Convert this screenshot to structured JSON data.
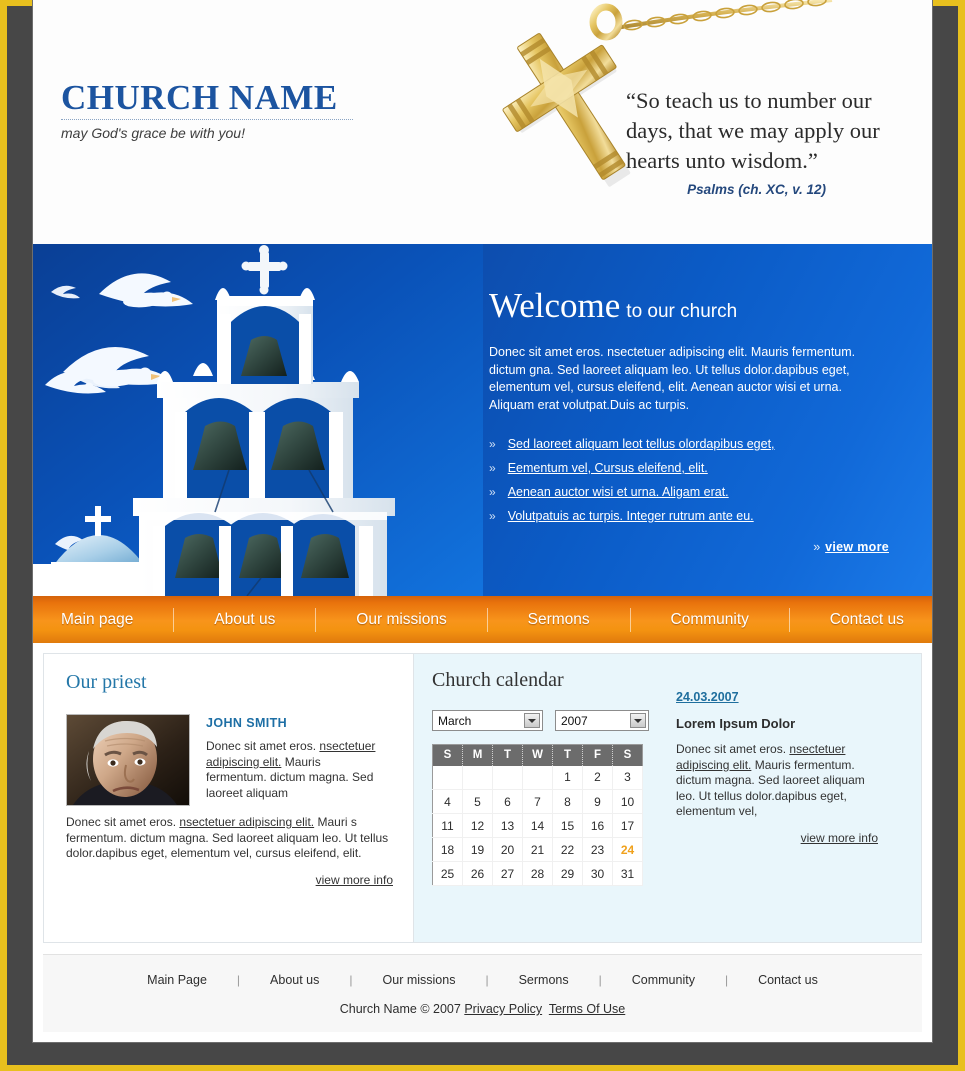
{
  "header": {
    "church_name": "CHURCH NAME",
    "tagline": "may God's grace be with you!",
    "quote": "“So teach us to number our days, that we may apply our hearts unto wisdom.”",
    "quote_source": "Psalms (ch. XC, v. 12)",
    "art_icon": "gold-cross-necklace"
  },
  "hero": {
    "heading_main": "Welcome",
    "heading_sub": "to our church",
    "paragraph": "Donec sit amet eros. nsectetuer adipiscing elit. Mauris fermentum. dictum gna. Sed laoreet aliquam leo. Ut tellus dolor.dapibus eget, elementum vel, cursus eleifend, elit. Aenean auctor wisi et urna. Aliquam erat volutpat.Duis ac turpis.",
    "bullet_glyph": "»",
    "links": [
      "Sed laoreet aliquam leot tellus olordapibus eget,",
      "Eementum vel, Cursus eleifend, elit.",
      "Aenean auctor wisi et urna. Aligam erat.",
      "Volutpatuis ac turpis. Integer rutrum ante eu."
    ],
    "view_more": "view more",
    "photo_alt": "white-bell-tower-with-doves"
  },
  "nav": {
    "items": [
      "Main page",
      "About us",
      "Our missions",
      "Sermons",
      "Community",
      "Contact us"
    ]
  },
  "priest": {
    "title": "Our priest",
    "photo_alt": "priest-portrait",
    "name": "JOHN SMITH",
    "intro_before": "Donec sit amet eros. ",
    "intro_link": "nsectetuer adipiscing elit.",
    "intro_after": " Mauris fermentum. dictum magna. Sed laoreet aliquam",
    "bio_before": "Donec sit amet eros. ",
    "bio_link": "nsectetuer adipiscing elit.",
    "bio_after": " Mauri s fermentum. dictum magna. Sed laoreet aliquam leo. Ut tellus dolor.dapibus eget, elementum vel, cursus eleifend, elit.",
    "view_more": "view more info"
  },
  "calendar": {
    "title": "Church calendar",
    "month": "March",
    "year": "2007",
    "weekday_headers": [
      "S",
      "M",
      "T",
      "W",
      "T",
      "F",
      "S"
    ],
    "weeks": [
      [
        "",
        "",
        "",
        "",
        "1",
        "2",
        "3"
      ],
      [
        "4",
        "5",
        "6",
        "7",
        "8",
        "9",
        "10"
      ],
      [
        "11",
        "12",
        "13",
        "14",
        "15",
        "16",
        "17"
      ],
      [
        "18",
        "19",
        "20",
        "21",
        "22",
        "23",
        "24"
      ],
      [
        "25",
        "26",
        "27",
        "28",
        "29",
        "30",
        "31"
      ]
    ],
    "selected_day": "24",
    "selected_color": "#f0a11c"
  },
  "news": {
    "date": "24.03.2007",
    "title": "Lorem Ipsum Dolor",
    "body_before": "Donec sit amet eros. ",
    "body_link": "nsectetuer adipiscing elit.",
    "body_after": " Mauris fermentum. dictum magna. Sed laoreet aliquam leo. Ut tellus dolor.dapibus eget, elementum vel,",
    "view_more": "view more info"
  },
  "footer": {
    "links": [
      "Main Page",
      "About us",
      "Our missions",
      "Sermons",
      "Community",
      "Contact us"
    ],
    "separator": "|",
    "copyright": "Church Name © 2007",
    "privacy": "Privacy Policy",
    "terms": "Terms Of Use"
  },
  "colors": {
    "outer_frame": "#e8c01e",
    "backdrop": "#474747",
    "brand_blue": "#1c54a0",
    "hero_blue": "#0b4fb2",
    "nav_orange": "#f8941b",
    "calendar_panel": "#e9f6fb",
    "accent_teal": "#2477a8"
  }
}
